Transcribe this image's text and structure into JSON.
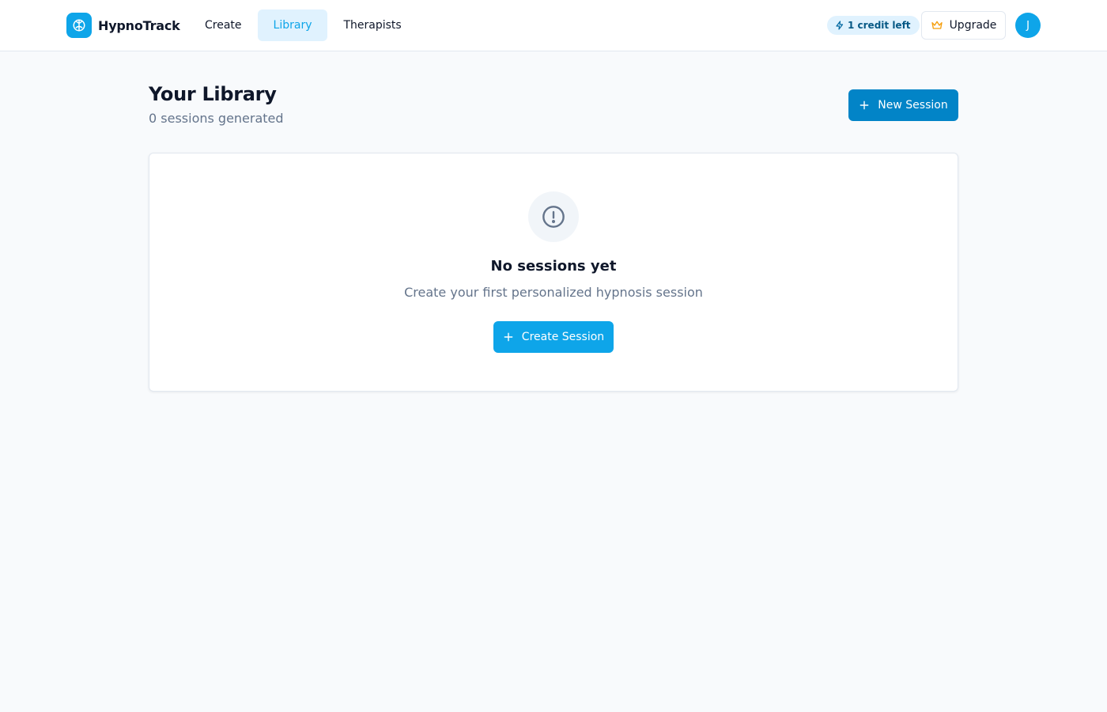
{
  "header": {
    "brand": "HypnoTrack",
    "nav": [
      {
        "label": "Create",
        "active": false
      },
      {
        "label": "Library",
        "active": true
      },
      {
        "label": "Therapists",
        "active": false
      }
    ],
    "credits": "1 credit left",
    "upgrade_label": "Upgrade",
    "avatar_initial": "J"
  },
  "main": {
    "title": "Your Library",
    "subtitle": "0 sessions generated",
    "new_session_label": "New Session",
    "empty_state": {
      "icon": "alert-circle-icon",
      "title": "No sessions yet",
      "text": "Create your first personalized hypnosis session",
      "cta_label": "Create Session"
    }
  },
  "colors": {
    "brand": "#0ea5e9",
    "primary_dark": "#0284c7",
    "active_nav_bg": "#e0f2fe",
    "upgrade_icon": "#f59e0b",
    "page_bg": "#f8fafc"
  }
}
